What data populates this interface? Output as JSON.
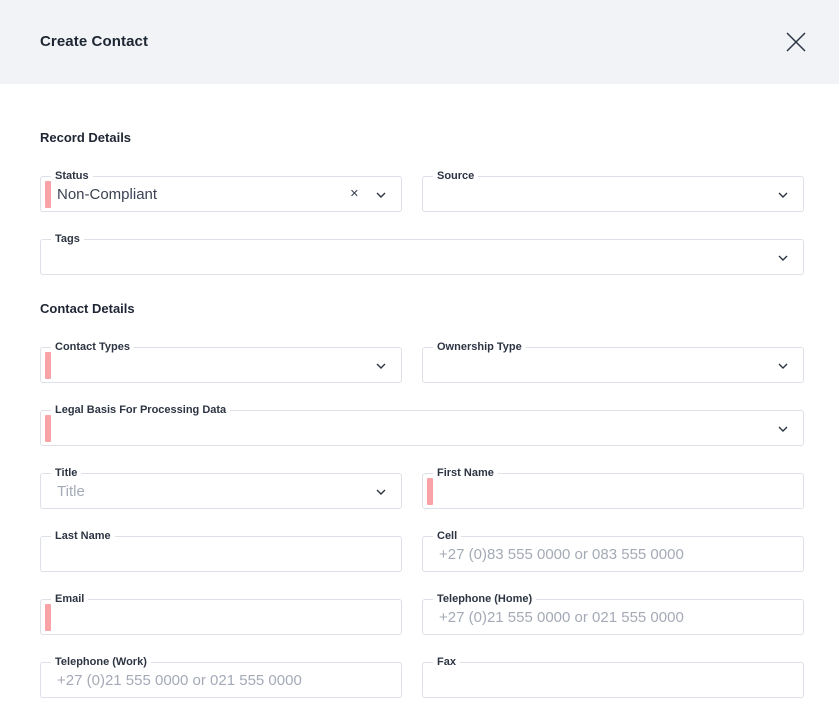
{
  "header": {
    "title": "Create Contact"
  },
  "sections": {
    "record": "Record Details",
    "contact": "Contact Details"
  },
  "fields": {
    "status": {
      "label": "Status",
      "value": "Non-Compliant"
    },
    "source": {
      "label": "Source"
    },
    "tags": {
      "label": "Tags"
    },
    "contact_types": {
      "label": "Contact Types"
    },
    "ownership_type": {
      "label": "Ownership Type"
    },
    "legal_basis": {
      "label": "Legal Basis For Processing Data"
    },
    "title": {
      "label": "Title",
      "placeholder": "Title"
    },
    "first_name": {
      "label": "First Name"
    },
    "last_name": {
      "label": "Last Name"
    },
    "cell": {
      "label": "Cell",
      "placeholder": "+27 (0)83 555 0000 or 083 555 0000"
    },
    "email": {
      "label": "Email"
    },
    "tel_home": {
      "label": "Telephone (Home)",
      "placeholder": "+27 (0)21 555 0000 or 021 555 0000"
    },
    "tel_work": {
      "label": "Telephone (Work)",
      "placeholder": "+27 (0)21 555 0000 or 021 555 0000"
    },
    "fax": {
      "label": "Fax"
    }
  },
  "icons": {
    "close": "close-icon",
    "chevron": "chevron-down-icon",
    "clear": "clear-icon"
  },
  "colors": {
    "header_bg": "#f1f3f6",
    "required_marker": "#f9a3a6",
    "border": "#dde1e7"
  }
}
